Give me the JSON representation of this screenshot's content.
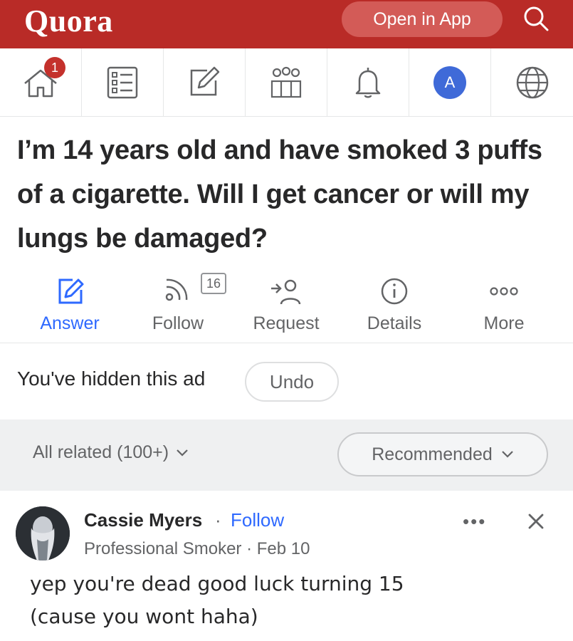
{
  "topbar": {
    "logo": "Quora",
    "open_in_app": "Open in App",
    "search_icon": "search-icon"
  },
  "nav": {
    "home_badge": "1",
    "avatar_letter": "A",
    "icons": [
      "home-icon",
      "answer-list-icon",
      "write-icon",
      "spaces-icon",
      "bell-icon",
      "avatar",
      "globe-icon"
    ]
  },
  "question": {
    "title": "I’m 14 years old and have smoked 3 puffs of a cigarette. Will I get cancer or will my lungs be damaged?"
  },
  "actions": {
    "answer": "Answer",
    "follow": "Follow",
    "follow_count": "16",
    "request": "Request",
    "details": "Details",
    "more": "More"
  },
  "hidden_ad": {
    "text": "You've hidden this ad",
    "undo": "Undo"
  },
  "related": {
    "all_related": "All related (100+)",
    "recommended": "Recommended"
  },
  "answer": {
    "author": "Cassie Myers",
    "separator": "·",
    "follow": "Follow",
    "credential": "Professional Smoker · Feb 10",
    "more": "•••",
    "text_line1": "yep you're dead good luck turning 15",
    "text_line2": "(cause you wont haha)"
  },
  "colors": {
    "brand_red": "#b92b27",
    "link_blue": "#2e69ff",
    "avatar_blue": "#3f6ad8"
  }
}
